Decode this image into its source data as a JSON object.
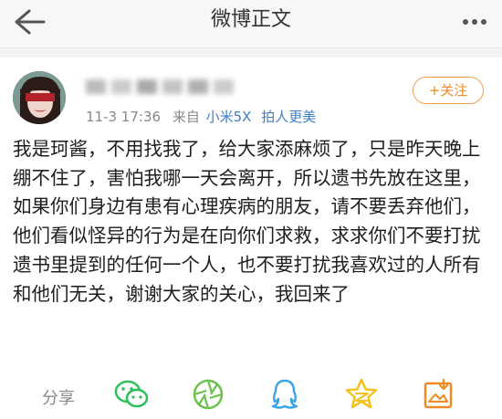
{
  "header": {
    "title": "微博正文",
    "back_icon": "back-arrow-icon",
    "more_icon": "more-dots-icon"
  },
  "post": {
    "time": "11-3 17:36",
    "source_prefix": "来自",
    "source": "小米5X",
    "source_suffix": "拍人更美",
    "follow_label": "+关注",
    "text": "我是珂酱，不用找我了，给大家添麻烦了，只是昨天晚上绷不住了，害怕我哪一天会离开，所以遗书先放在这里，如果你们身边有患有心理疾病的朋友，请不要丢弃他们，他们看似怪异的行为是在向你们求救，求求你们不要打扰遗书里提到的任何一个人，也不要打扰我喜欢过的人所有和他们无关，谢谢大家的关心，我回来了"
  },
  "share": {
    "label": "分享",
    "targets": [
      "wechat-icon",
      "moments-icon",
      "qq-icon",
      "qzone-icon",
      "save-image-icon"
    ]
  },
  "colors": {
    "accent_orange": "#f08a22",
    "link_blue": "#3f7fc4",
    "wechat_green": "#2fbf5a",
    "qq_blue": "#3aa3e3",
    "qzone_yellow": "#f4c21a"
  }
}
